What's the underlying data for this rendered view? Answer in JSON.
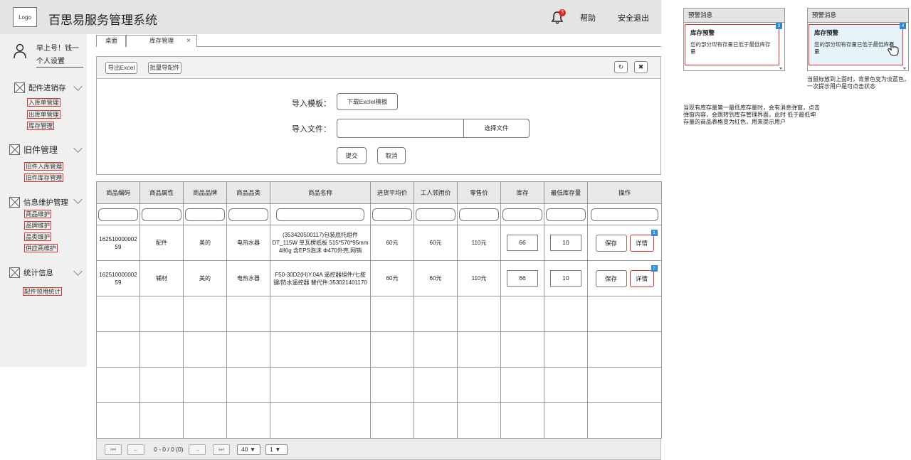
{
  "header": {
    "logo": "Logo",
    "title": "百思易服务管理系统",
    "bell_badge": "3",
    "help": "帮助",
    "logout": "安全退出"
  },
  "sidebar": {
    "greeting": "早上号！钱一",
    "settings": "个人设置",
    "groups": [
      {
        "title": "配件进销存",
        "items": [
          "入库单管理",
          "出库单管理",
          "库存管理"
        ]
      },
      {
        "title": "旧件管理",
        "items": [
          "旧件入库管理",
          "旧件库存管理"
        ]
      },
      {
        "title": "信息维护管理",
        "items": [
          "商品维护",
          "品牌维护",
          "品类维护",
          "供应商维护"
        ]
      },
      {
        "title": "统计信息",
        "items": [
          "配件领用统计"
        ]
      }
    ]
  },
  "tabs": [
    {
      "label": "桌面"
    },
    {
      "label": "库存管理",
      "close": "×"
    }
  ],
  "import": {
    "export_btn": "导出Excel",
    "batch_btn": "批量导配件",
    "refresh_icon": "↻",
    "close_icon": "✖",
    "template_label": "导入模板：",
    "download_btn": "下载Exclel模板",
    "file_label": "导入文件：",
    "choose_btn": "选择文件",
    "submit_btn": "提交",
    "cancel_btn": "取消"
  },
  "table": {
    "columns": [
      "商品编码",
      "商品属性",
      "商品品牌",
      "商品品类",
      "商品名称",
      "进货平均价",
      "工人领用价",
      "零售价",
      "库存",
      "最低库存量",
      "操作"
    ],
    "rows": [
      {
        "code": "16251000000259",
        "attr": "配件",
        "brand": "美的",
        "category": "电热水器",
        "name": "(353420500117)包装底托组件 DT_115W 单瓦楞纸板 515*570*95mm 480g 含EPS泡沫 Φ470外壳,网销",
        "avg_price": "60元",
        "worker_price": "60元",
        "retail": "110元",
        "stock": "66",
        "min_stock": "10",
        "save": "保存",
        "detail": "详情",
        "note": "1"
      },
      {
        "code": "16251000000259",
        "attr": "辅材",
        "brand": "美的",
        "category": "电热水器",
        "name": "F50-30D2(H)Y.04A 遥控器组件/七按键/防水遥控器 替代件:353021401170",
        "avg_price": "60元",
        "worker_price": "60元",
        "retail": "110元",
        "stock": "66",
        "min_stock": "10",
        "save": "保存",
        "detail": "详情",
        "note": "2"
      }
    ]
  },
  "pager": {
    "first": "⏮",
    "prev": "←",
    "info": "0 - 0 / 0 (0)",
    "next": "→",
    "last": "⏭",
    "page_size": "40 ▼",
    "page_num": "1 ▼"
  },
  "annotations": {
    "popup_head": "预警消息",
    "popup_title": "库存预警",
    "popup_msg": "您的部分现有存量已低于最低库存量",
    "popup1_num": "3",
    "popup2_num": "4",
    "hover_note": "当鼠标放到上面时，背景色变为淡蓝色，一次提示用户是可点击状态",
    "trigger_note": "当现有库存量第一最低库存量时，会有消息弹窗，点击弹窗内容，会跳转到库存管理界面，此时 低于最低坤存量的商品表格变为红色，用来提示用户"
  }
}
